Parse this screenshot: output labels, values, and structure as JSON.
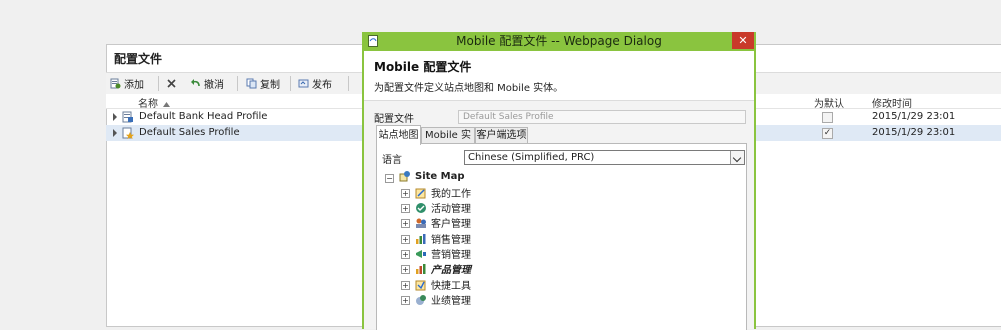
{
  "app": {
    "title": "配置文件",
    "toolbar": {
      "add": "添加",
      "delete_icon": "close-icon",
      "cancel": "撤消",
      "copy": "复制",
      "publish": "发布"
    },
    "grid": {
      "columns": {
        "name": "名称",
        "is_default": "为默认",
        "modified_on": "修改时间"
      },
      "rows": [
        {
          "name": "Default Bank Head Profile",
          "is_default": false,
          "modified_on": "2015/1/29 23:01"
        },
        {
          "name": "Default Sales Profile",
          "is_default": true,
          "modified_on": "2015/1/29 23:01"
        }
      ]
    }
  },
  "dialog": {
    "window_title": "Mobile 配置文件 -- Webpage Dialog",
    "close_glyph": "✕",
    "header_title": "Mobile 配置文件",
    "header_subtitle": "为配置文件定义站点地图和 Mobile 实体。",
    "profile_label": "配置文件",
    "profile_value": "Default Sales Profile",
    "tabs": [
      {
        "label": "站点地图",
        "active": true
      },
      {
        "label": "Mobile 实体",
        "active": false
      },
      {
        "label": "客户端选项",
        "active": false
      }
    ],
    "language_label": "语言",
    "language_value": "Chinese (Simplified, PRC)",
    "tree": {
      "root": "Site Map",
      "items": [
        "我的工作",
        "活动管理",
        "客户管理",
        "销售管理",
        "营销管理",
        "产品管理",
        "快捷工具",
        "业绩管理"
      ]
    }
  },
  "colors": {
    "dialog_frame": "#8ac43f",
    "close_button": "#c93a2a",
    "selected_row": "#dfe9f5"
  }
}
